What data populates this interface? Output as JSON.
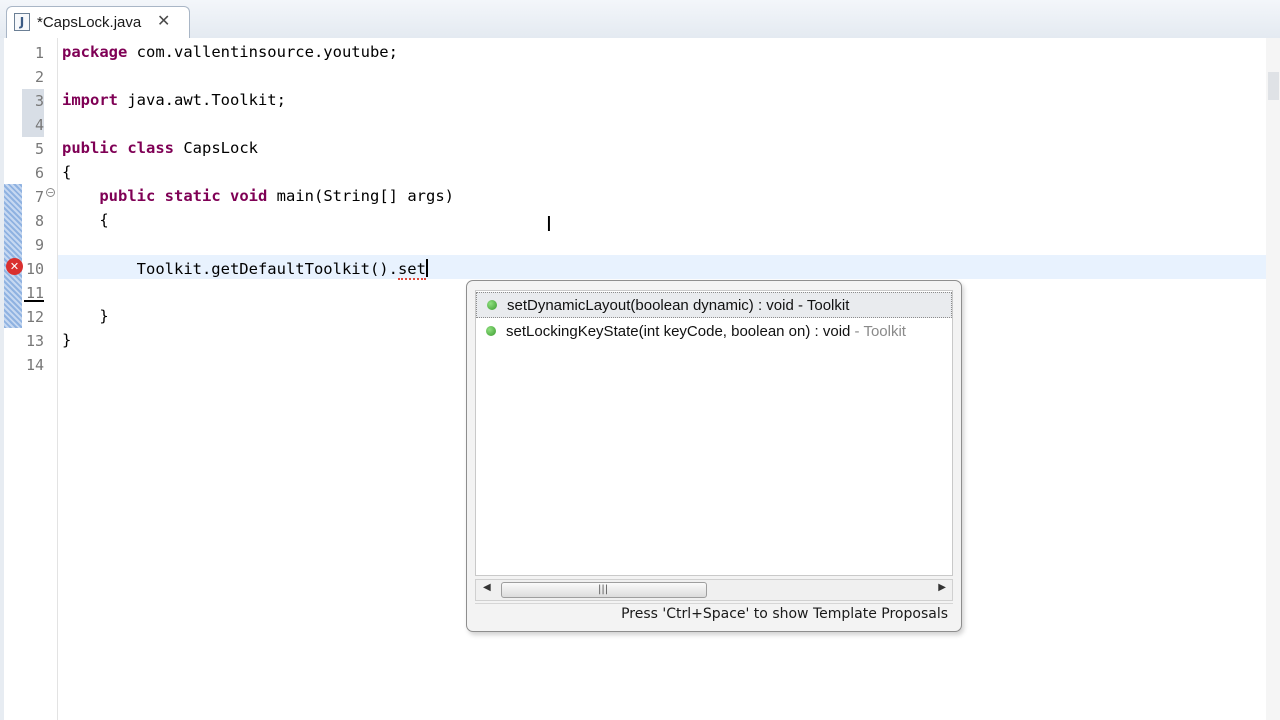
{
  "tab": {
    "icon": "java-file-icon",
    "title": "*CapsLock.java",
    "close_glyph": "✕"
  },
  "editor": {
    "lines": [
      {
        "num": "1",
        "parts": [
          {
            "kw": "package"
          },
          {
            "t": " com.vallentinsource.youtube;"
          }
        ]
      },
      {
        "num": "2",
        "parts": []
      },
      {
        "num": "3",
        "parts": [
          {
            "kw": "import"
          },
          {
            "t": " java.awt.Toolkit;"
          }
        ]
      },
      {
        "num": "4",
        "parts": []
      },
      {
        "num": "5",
        "parts": [
          {
            "kw": "public"
          },
          {
            "t": " "
          },
          {
            "kw": "class"
          },
          {
            "t": " CapsLock"
          }
        ]
      },
      {
        "num": "6",
        "parts": [
          {
            "t": "{"
          }
        ]
      },
      {
        "num": "7",
        "parts": [
          {
            "t": "    "
          },
          {
            "kw": "public"
          },
          {
            "t": " "
          },
          {
            "kw": "static"
          },
          {
            "t": " "
          },
          {
            "kw": "void"
          },
          {
            "t": " main(String[] args)"
          }
        ]
      },
      {
        "num": "8",
        "parts": [
          {
            "t": "    {"
          }
        ]
      },
      {
        "num": "9",
        "parts": []
      },
      {
        "num": "10",
        "parts": [
          {
            "t": "        Toolkit.getDefaultToolkit()."
          },
          {
            "err": "set"
          },
          {
            "caret": true
          }
        ]
      },
      {
        "num": "11",
        "parts": []
      },
      {
        "num": "12",
        "parts": [
          {
            "t": "    }"
          }
        ]
      },
      {
        "num": "13",
        "parts": [
          {
            "t": "}"
          }
        ]
      },
      {
        "num": "14",
        "parts": []
      }
    ],
    "error_line": "10",
    "colors": {
      "keyword": "#7f0055",
      "current_line": "#e8f2fe",
      "error": "#d9302f"
    }
  },
  "content_assist": {
    "proposals": [
      {
        "text": "setDynamicLayout(boolean dynamic) : void - Toolkit",
        "owner_faded": "",
        "selected": true,
        "icon": "public-method-icon"
      },
      {
        "text": "setLockingKeyState(int keyCode, boolean on) : void ",
        "owner_faded": "- Toolkit",
        "selected": false,
        "icon": "public-method-icon"
      }
    ],
    "status": "Press 'Ctrl+Space' to show Template Proposals",
    "scroll_grip": "|||"
  }
}
